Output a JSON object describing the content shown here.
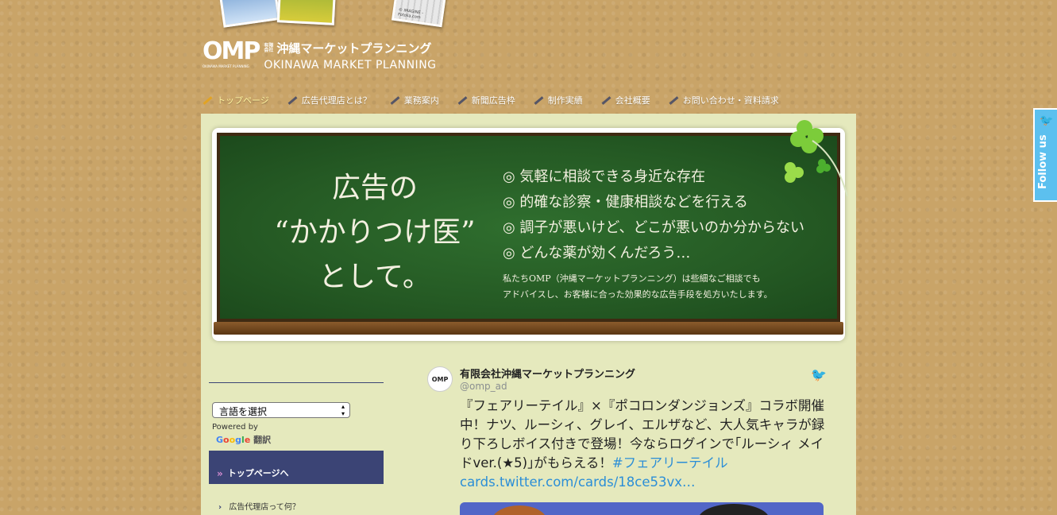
{
  "header": {
    "photo_caption": "© IMAGINE - Fotolia.com",
    "logo_mark": "OMP",
    "logo_tagline": "OKINAWA MARKET PLANNING",
    "logo_company_type": "有限会社",
    "logo_jp": "沖縄マーケットプランニング",
    "logo_en": "OKINAWA MARKET PLANNING"
  },
  "nav": {
    "items": [
      {
        "label": "トップページ"
      },
      {
        "label": "広告代理店とは？"
      },
      {
        "label": "業務案内"
      },
      {
        "label": "新聞広告枠"
      },
      {
        "label": "制作実績"
      },
      {
        "label": "会社概要"
      },
      {
        "label": "お問い合わせ・資料請求"
      }
    ]
  },
  "banner": {
    "line1": "広告の",
    "line2": "“かかりつけ医”",
    "line3": "として。",
    "bullets": [
      "◎ 気軽に相談できる身近な存在",
      "◎ 的確な診察・健康相談などを行える",
      "◎ 調子が悪いけど、どこが悪いのか分からない",
      "◎ どんな薬が効くんだろう…"
    ],
    "desc1": "私たちOMP（沖縄マーケットプランニング）は些細なご相談でも",
    "desc2": "アドバイスし、お客様に合った効果的な広告手段を処方いたします。"
  },
  "sidebar": {
    "language_select": "言語を選択",
    "powered_by": "Powered by",
    "google_translate": "翻訳",
    "top_page_link": "トップページへ",
    "link1": "広告代理店って何？"
  },
  "tweet": {
    "avatar": "OMP",
    "name": "有限会社沖縄マーケットプランニング",
    "handle": "@omp_ad",
    "body": "『フェアリーテイル』×『ポコロンダンジョンズ』コラボ開催中！ナツ、ルーシィ、グレイ、エルザなど、大人気キャラが録り下ろしボイス付きで登場！今ならログインで｢ルーシィ メイドver.(★5)｣がもらえる！",
    "hashtag": "#フェアリーテイル",
    "link": "cards.twitter.com/cards/18ce53vx…"
  },
  "follow": {
    "label": "Follow us"
  }
}
